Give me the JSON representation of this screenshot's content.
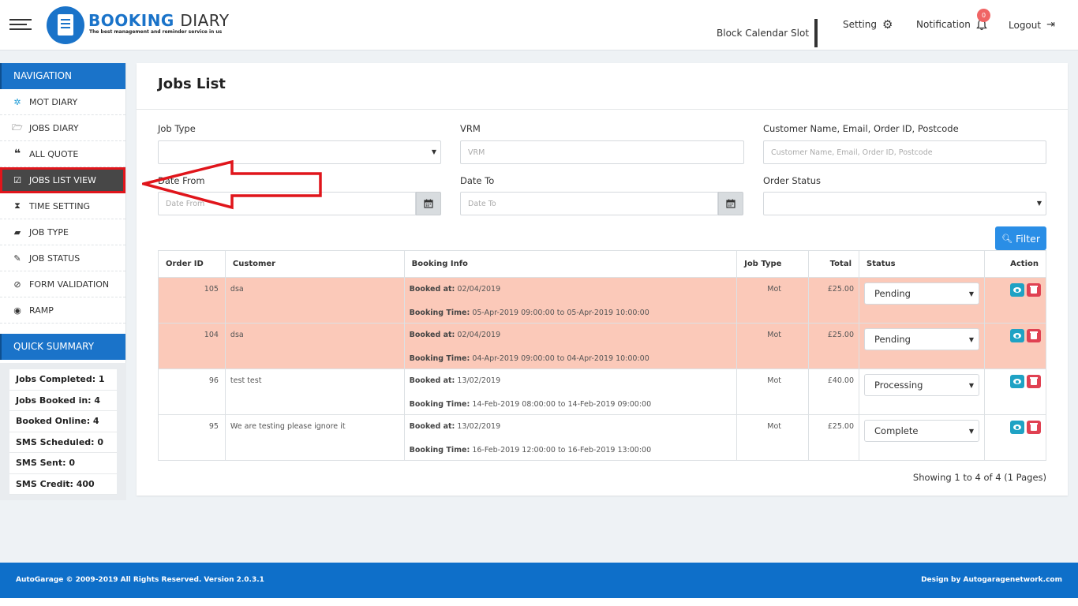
{
  "header": {
    "brand_primary": "BOOKING",
    "brand_secondary": "DIARY",
    "tagline": "The best management and reminder service in us",
    "nav": {
      "block_calendar": "Block Calendar Slot",
      "setting": "Setting",
      "notification": "Notification",
      "notification_count": "0",
      "logout": "Logout"
    }
  },
  "sidebar": {
    "nav_heading": "NAVIGATION",
    "items": [
      {
        "label": "MOT DIARY",
        "icon": "mot-icon"
      },
      {
        "label": "JOBS DIARY",
        "icon": "folder-icon"
      },
      {
        "label": "ALL QUOTE",
        "icon": "quote-icon"
      },
      {
        "label": "JOBS LIST VIEW",
        "icon": "calendar-check-icon"
      },
      {
        "label": "TIME SETTING",
        "icon": "hourglass-icon"
      },
      {
        "label": "JOB TYPE",
        "icon": "briefcase-icon"
      },
      {
        "label": "JOB STATUS",
        "icon": "edit-icon"
      },
      {
        "label": "FORM VALIDATION",
        "icon": "ban-icon"
      },
      {
        "label": "RAMP",
        "icon": "compass-icon"
      }
    ],
    "summary_heading": "QUICK SUMMARY",
    "summary": [
      "Jobs Completed: 1",
      "Jobs Booked in: 4",
      "Booked Online: 4",
      "SMS Scheduled: 0",
      "SMS Sent: 0",
      "SMS Credit: 400"
    ]
  },
  "main": {
    "title": "Jobs List",
    "filters": {
      "job_type_label": "Job Type",
      "job_type_value": "",
      "vrm_label": "VRM",
      "vrm_placeholder": "VRM",
      "customer_label": "Customer Name, Email, Order ID, Postcode",
      "customer_placeholder": "Customer Name, Email, Order ID, Postcode",
      "date_from_label": "Date From",
      "date_from_placeholder": "Date From",
      "date_to_label": "Date To",
      "date_to_placeholder": "Date To",
      "order_status_label": "Order Status",
      "order_status_value": "",
      "filter_button": "Filter"
    },
    "table": {
      "headers": [
        "Order ID",
        "Customer",
        "Booking Info",
        "Job Type",
        "Total",
        "Status",
        "Action"
      ],
      "booked_at_label": "Booked at:",
      "booking_time_label": "Booking Time:",
      "rows": [
        {
          "order_id": "105",
          "customer": "dsa",
          "booked_at": "02/04/2019",
          "booking_time": "05-Apr-2019 09:00:00 to 05-Apr-2019 10:00:00",
          "job_type": "Mot",
          "total": "£25.00",
          "status": "Pending",
          "highlight": true
        },
        {
          "order_id": "104",
          "customer": "dsa",
          "booked_at": "02/04/2019",
          "booking_time": "04-Apr-2019 09:00:00 to 04-Apr-2019 10:00:00",
          "job_type": "Mot",
          "total": "£25.00",
          "status": "Pending",
          "highlight": true
        },
        {
          "order_id": "96",
          "customer": "test test",
          "booked_at": "13/02/2019",
          "booking_time": "14-Feb-2019 08:00:00 to 14-Feb-2019 09:00:00",
          "job_type": "Mot",
          "total": "£40.00",
          "status": "Processing",
          "highlight": false
        },
        {
          "order_id": "95",
          "customer": "We are testing please ignore it",
          "booked_at": "13/02/2019",
          "booking_time": "16-Feb-2019 12:00:00 to 16-Feb-2019 13:00:00",
          "job_type": "Mot",
          "total": "£25.00",
          "status": "Complete",
          "highlight": false
        }
      ]
    },
    "pagination_text": "Showing 1 to 4 of 4 (1 Pages)"
  },
  "footer": {
    "left": "AutoGarage © 2009-2019 All Rights Reserved. Version 2.0.3.1",
    "right": "Design by Autogaragenetwork.com"
  },
  "colors": {
    "brand_blue": "#1a73c9",
    "footer_blue": "#0e6fc9",
    "highlight_row": "#fbc9b9",
    "annotation_red": "#e0151b",
    "view_button": "#1fa2c4",
    "delete_button": "#e04152"
  }
}
